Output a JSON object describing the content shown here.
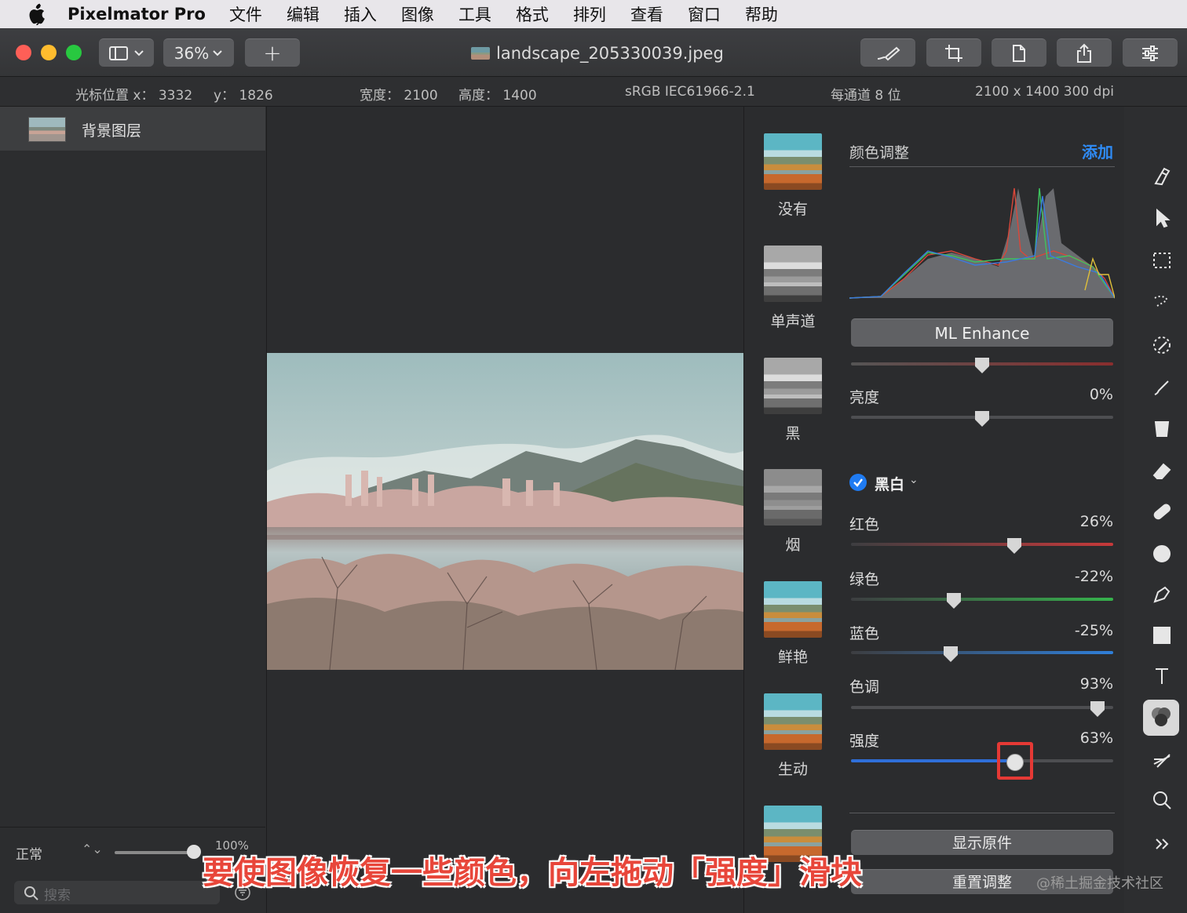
{
  "menubar": {
    "app_name": "Pixelmator Pro",
    "items": [
      "文件",
      "编辑",
      "插入",
      "图像",
      "工具",
      "格式",
      "排列",
      "查看",
      "窗口",
      "帮助"
    ]
  },
  "toolbar": {
    "zoom": "36%",
    "add_symbol": "+",
    "document_title": "landscape_205330039.jpeg"
  },
  "infobar": {
    "cursor_x": "光标位置 x： 3332",
    "cursor_y": "y： 1826",
    "width": "宽度： 2100",
    "height": "高度： 1400",
    "color_profile": "sRGB IEC61966-2.1",
    "bits": "每通道 8 位",
    "dimensions": "2100 x 1400 300 dpi"
  },
  "layers": {
    "layer_name": "背景图层",
    "blend_mode": "正常",
    "opacity": "100%",
    "search_placeholder": "搜索"
  },
  "presets": [
    "没有",
    "单声道",
    "黑",
    "烟",
    "鲜艳",
    "生动"
  ],
  "adjustments": {
    "title": "颜色调整",
    "add_label": "添加",
    "ml_enhance": "ML Enhance",
    "brightness_label": "亮度",
    "brightness_value": "0%",
    "bw_label": "黑白",
    "sliders": [
      {
        "label": "红色",
        "value": "26%"
      },
      {
        "label": "绿色",
        "value": "-22%"
      },
      {
        "label": "蓝色",
        "value": "-25%"
      },
      {
        "label": "色调",
        "value": "93%"
      },
      {
        "label": "强度",
        "value": "63%"
      }
    ],
    "show_original": "显示原件",
    "reset": "重置调整"
  },
  "caption": "要使图像恢复一些颜色，向左拖动「强度」滑块",
  "watermark": "@稀土掘金技术社区",
  "colors": {
    "accent_blue": "#2f8bf5",
    "highlight_red": "#e53935",
    "traffic_red": "#fe5f57",
    "traffic_yellow": "#febc2e",
    "traffic_green": "#28c840"
  }
}
